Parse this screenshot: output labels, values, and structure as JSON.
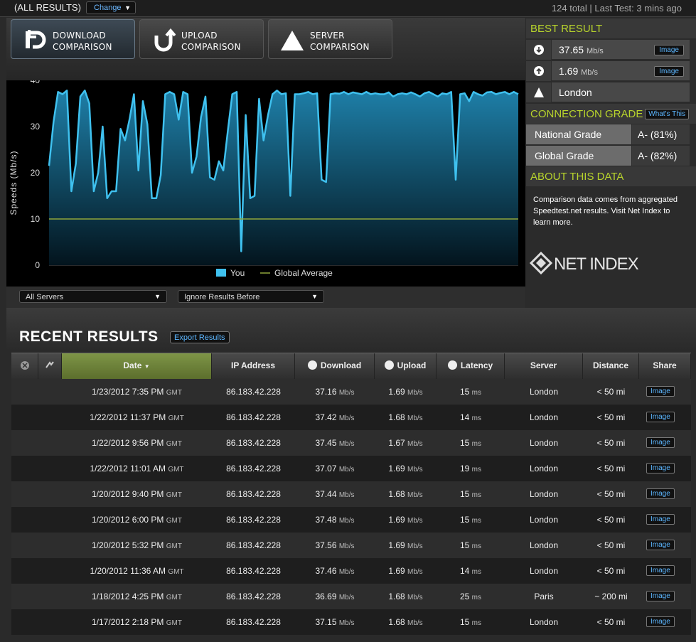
{
  "top": {
    "filter_label": "(ALL RESULTS)",
    "change_label": "Change",
    "summary": "124 total | Last Test: 3 mins ago"
  },
  "tabs": [
    {
      "line1": "DOWNLOAD",
      "line2": "COMPARISON",
      "icon": "download-icon",
      "active": true
    },
    {
      "line1": "UPLOAD",
      "line2": "COMPARISON",
      "icon": "upload-icon",
      "active": false
    },
    {
      "line1": "SERVER",
      "line2": "COMPARISON",
      "icon": "server-icon",
      "active": false
    }
  ],
  "filters": {
    "servers": "All Servers",
    "ignore": "Ignore Results Before"
  },
  "chart_data": {
    "type": "area",
    "ylabel": "Speeds (Mb/s)",
    "ylim": [
      0,
      40
    ],
    "yticks": [
      0,
      10,
      20,
      30,
      40
    ],
    "grid": false,
    "legend": {
      "placement": "bottom-center"
    },
    "series": [
      {
        "name": "You",
        "color": "#3fc1ef",
        "values": [
          21.5,
          31,
          37.5,
          37,
          37.8,
          16,
          22,
          36.5,
          37.8,
          35,
          16,
          20,
          30,
          14.5,
          16,
          16,
          29.5,
          27,
          31.5,
          37,
          20.5,
          35.5,
          30.5,
          14.5,
          14.5,
          19.5,
          37,
          37.5,
          37,
          31.5,
          37.5,
          37,
          20,
          23.5,
          32,
          36.5,
          19,
          18.5,
          22.5,
          20.5,
          29,
          37,
          37.5,
          3,
          32.5,
          14.5,
          15,
          36,
          27,
          32.5,
          37,
          37.8,
          37,
          37.2,
          15,
          37,
          37,
          37.2,
          37.5,
          37,
          37.2,
          18.5,
          18,
          37,
          37.2,
          37.1,
          37.5,
          37,
          37.4,
          37.2,
          37,
          37.5,
          37,
          37.2,
          37,
          37,
          37.4,
          36.5,
          37,
          37.2,
          37,
          37.4,
          37,
          36.5,
          37.2,
          37.5,
          37,
          36.5,
          37.2,
          37,
          37.5,
          18.5,
          37,
          37.2,
          35.5,
          37.5,
          37,
          36.7,
          37.4,
          37.5,
          37,
          37.3,
          37.5,
          37,
          37.5,
          37
        ]
      },
      {
        "name": "Global Average",
        "color": "#8fa63a",
        "values": [
          10
        ]
      }
    ]
  },
  "right": {
    "best_title": "BEST RESULT",
    "best": [
      {
        "icon": "download-icon",
        "value": "37.65",
        "unit": "Mb/s",
        "btn": "Image"
      },
      {
        "icon": "upload-icon",
        "value": "1.69",
        "unit": "Mb/s",
        "btn": "Image"
      },
      {
        "icon": "server-icon",
        "value": "London",
        "unit": "",
        "btn": ""
      }
    ],
    "grade_title": "CONNECTION GRADE",
    "whats_this": "What's This",
    "grades": [
      {
        "label": "National Grade",
        "value": "A- (81%)"
      },
      {
        "label": "Global Grade",
        "value": "A- (82%)"
      }
    ],
    "about_title": "ABOUT THIS DATA",
    "about_text": "Comparison data comes from aggregated Speedtest.net results. Visit Net Index to learn more.",
    "logo_text": "NET INDEX",
    "accent": "#b8d42c"
  },
  "recent": {
    "title": "RECENT RESULTS",
    "export": "Export Results",
    "columns": [
      "Date",
      "IP Address",
      "Download",
      "Upload",
      "Latency",
      "Server",
      "Distance",
      "Share"
    ],
    "rows": [
      {
        "date": "1/23/2012 7:35 PM",
        "tz": "GMT",
        "ip": "86.183.42.228",
        "down": "37.16",
        "up": "1.69",
        "lat": "15",
        "server": "London",
        "dist": "< 50 mi",
        "share": "Image"
      },
      {
        "date": "1/22/2012 11:37 PM",
        "tz": "GMT",
        "ip": "86.183.42.228",
        "down": "37.42",
        "up": "1.68",
        "lat": "14",
        "server": "London",
        "dist": "< 50 mi",
        "share": "Image"
      },
      {
        "date": "1/22/2012 9:56 PM",
        "tz": "GMT",
        "ip": "86.183.42.228",
        "down": "37.45",
        "up": "1.67",
        "lat": "15",
        "server": "London",
        "dist": "< 50 mi",
        "share": "Image"
      },
      {
        "date": "1/22/2012 11:01 AM",
        "tz": "GMT",
        "ip": "86.183.42.228",
        "down": "37.07",
        "up": "1.69",
        "lat": "19",
        "server": "London",
        "dist": "< 50 mi",
        "share": "Image"
      },
      {
        "date": "1/20/2012 9:40 PM",
        "tz": "GMT",
        "ip": "86.183.42.228",
        "down": "37.44",
        "up": "1.68",
        "lat": "15",
        "server": "London",
        "dist": "< 50 mi",
        "share": "Image"
      },
      {
        "date": "1/20/2012 6:00 PM",
        "tz": "GMT",
        "ip": "86.183.42.228",
        "down": "37.48",
        "up": "1.69",
        "lat": "15",
        "server": "London",
        "dist": "< 50 mi",
        "share": "Image"
      },
      {
        "date": "1/20/2012 5:32 PM",
        "tz": "GMT",
        "ip": "86.183.42.228",
        "down": "37.56",
        "up": "1.69",
        "lat": "15",
        "server": "London",
        "dist": "< 50 mi",
        "share": "Image"
      },
      {
        "date": "1/20/2012 11:36 AM",
        "tz": "GMT",
        "ip": "86.183.42.228",
        "down": "37.46",
        "up": "1.69",
        "lat": "14",
        "server": "London",
        "dist": "< 50 mi",
        "share": "Image"
      },
      {
        "date": "1/18/2012 4:25 PM",
        "tz": "GMT",
        "ip": "86.183.42.228",
        "down": "36.69",
        "up": "1.68",
        "lat": "25",
        "server": "Paris",
        "dist": "~ 200 mi",
        "share": "Image"
      },
      {
        "date": "1/17/2012 2:18 PM",
        "tz": "GMT",
        "ip": "86.183.42.228",
        "down": "37.15",
        "up": "1.68",
        "lat": "15",
        "server": "London",
        "dist": "< 50 mi",
        "share": "Image"
      }
    ],
    "unit_speed": "Mb/s",
    "unit_latency": "ms"
  }
}
